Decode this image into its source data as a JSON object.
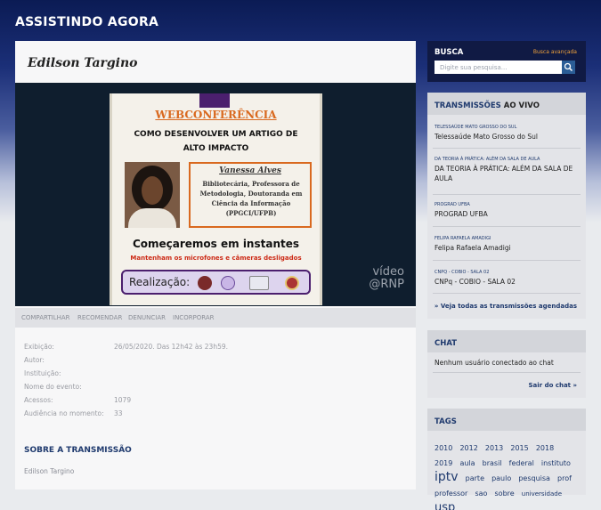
{
  "header": {
    "title": "ASSISTINDO AGORA"
  },
  "video": {
    "title": "Edilson Targino",
    "slide": {
      "webconf": "WEBCONFERÊNCIA",
      "subtitle": "COMO DESENVOLVER UM ARTIGO DE ALTO IMPACTO",
      "speaker_name": "Vanessa Alves",
      "speaker_desc": "Bibliotecária, Professora de Metodologia, Doutoranda em Ciência da Informação (PPGCI/UFPB)",
      "start": "Começaremos em instantes",
      "mic_note": "Mantenham os microfones e câmeras desligados",
      "realizacao": "Realização:"
    },
    "watermark_line1": "vídeo",
    "watermark_line2": "@RNP"
  },
  "tabs": [
    "COMPARTILHAR",
    "RECOMENDAR",
    "DENUNCIAR",
    "INCORPORAR"
  ],
  "details": [
    {
      "label": "Exibição:",
      "value": "26/05/2020. Das 12h42 às 23h59."
    },
    {
      "label": "Autor:",
      "value": ""
    },
    {
      "label": "Instituição:",
      "value": ""
    },
    {
      "label": "Nome do evento:",
      "value": ""
    },
    {
      "label": "Acessos:",
      "value": "1079"
    },
    {
      "label": "Audiência no momento:",
      "value": "33"
    }
  ],
  "sobre": {
    "heading": "SOBRE A TRANSMISSÃO",
    "text": "Edilson Targino"
  },
  "busca": {
    "title": "BUSCA",
    "advanced": "Busca avançada",
    "placeholder": "Digite sua pesquisa..."
  },
  "transmissoes": {
    "heading_a": "TRANSMISSÕES",
    "heading_b": " AO VIVO",
    "items": [
      {
        "channel": "TELESSAÚDE MATO GROSSO DO SUL",
        "title": "Telessaúde Mato Grosso do Sul"
      },
      {
        "channel": "DA TEORIA À PRÁTICA: ALÉM DA SALA DE AULA",
        "title": "DA TEORIA À PRÁTICA: ALÉM DA SALA DE AULA"
      },
      {
        "channel": "PROGRAD UFBA",
        "title": "PROGRAD UFBA"
      },
      {
        "channel": "FELIPA RAFAELA AMADIGI",
        "title": "Felipa Rafaela Amadigi"
      },
      {
        "channel": "CNPQ - COBIO - SALA 02",
        "title": "CNPq - COBIO - SALA 02"
      }
    ],
    "see_all": "» Veja todas as transmissões agendadas"
  },
  "chat": {
    "heading": "CHAT",
    "status": "Nenhum usuário conectado ao chat",
    "exit": "Sair do chat »"
  },
  "tags": {
    "heading": "TAGS",
    "items": [
      {
        "text": "2010",
        "size": 8
      },
      {
        "text": "2012",
        "size": 8
      },
      {
        "text": "2013",
        "size": 8
      },
      {
        "text": "2015",
        "size": 8
      },
      {
        "text": "2018",
        "size": 8
      },
      {
        "text": "2019",
        "size": 8
      },
      {
        "text": "aula",
        "size": 8
      },
      {
        "text": "brasil",
        "size": 8
      },
      {
        "text": "federal",
        "size": 8
      },
      {
        "text": "instituto",
        "size": 8
      },
      {
        "text": "iptv",
        "size": 14
      },
      {
        "text": "parte",
        "size": 8
      },
      {
        "text": "paulo",
        "size": 8
      },
      {
        "text": "pesquisa",
        "size": 8
      },
      {
        "text": "prof",
        "size": 8
      },
      {
        "text": "professor",
        "size": 8
      },
      {
        "text": "sao",
        "size": 8
      },
      {
        "text": "sobre",
        "size": 8
      },
      {
        "text": "universidade",
        "size": 7
      },
      {
        "text": "usp",
        "size": 13
      }
    ]
  }
}
